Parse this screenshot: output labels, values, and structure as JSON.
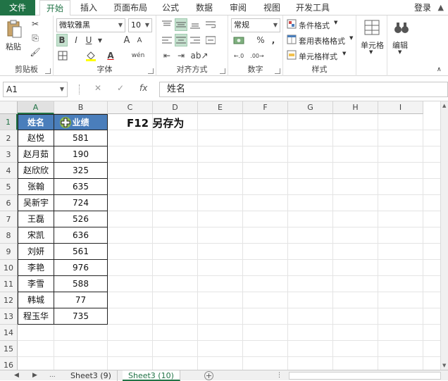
{
  "menu": {
    "file": "文件",
    "tabs": [
      "开始",
      "插入",
      "页面布局",
      "公式",
      "数据",
      "审阅",
      "视图",
      "开发工具"
    ],
    "login": "登录"
  },
  "ribbon": {
    "clipboard": {
      "label": "剪贴板",
      "paste": "粘贴"
    },
    "font": {
      "label": "字体",
      "font_name": "微软雅黑",
      "font_size": "10",
      "bold": "B",
      "italic": "I",
      "underline": "U",
      "grow": "A",
      "shrink": "A",
      "color_a": "A",
      "wen": "wén"
    },
    "alignment": {
      "label": "对齐方式"
    },
    "number": {
      "label": "数字",
      "format": "常规",
      "percent": "%",
      "comma": ","
    },
    "styles": {
      "label": "样式",
      "conditional": "条件格式",
      "table": "套用表格格式",
      "cell_style": "单元格样式"
    },
    "cells": {
      "label": "单元格"
    },
    "editing": {
      "label": "编辑"
    }
  },
  "formula_bar": {
    "name_box": "A1",
    "cancel": "✕",
    "enter": "✓",
    "fx": "fx",
    "content": "姓名"
  },
  "columns": [
    "A",
    "B",
    "C",
    "D",
    "E",
    "F",
    "G",
    "H",
    "I"
  ],
  "rows": [
    "1",
    "2",
    "3",
    "4",
    "5",
    "6",
    "7",
    "8",
    "9",
    "10",
    "11",
    "12",
    "13",
    "14",
    "15",
    "16"
  ],
  "table": {
    "headers": [
      "姓名",
      "业绩"
    ],
    "rows": [
      [
        "赵悦",
        "581"
      ],
      [
        "赵月茹",
        "190"
      ],
      [
        "赵欣欣",
        "325"
      ],
      [
        "张翰",
        "635"
      ],
      [
        "吴新宇",
        "724"
      ],
      [
        "王磊",
        "526"
      ],
      [
        "宋凯",
        "636"
      ],
      [
        "刘妍",
        "561"
      ],
      [
        "李艳",
        "976"
      ],
      [
        "李雪",
        "588"
      ],
      [
        "韩城",
        "77"
      ],
      [
        "程玉华",
        "735"
      ]
    ]
  },
  "note": "F12 另存为",
  "sheets": {
    "nav_prev": "◀",
    "nav_next": "▶",
    "more": "...",
    "tabs": [
      "Sheet3 (9)",
      "Sheet3 (10)"
    ],
    "active": "Sheet3 (10)",
    "add": "+"
  },
  "colors": {
    "accent": "#217346",
    "header_fill": "#4a7ebb"
  }
}
